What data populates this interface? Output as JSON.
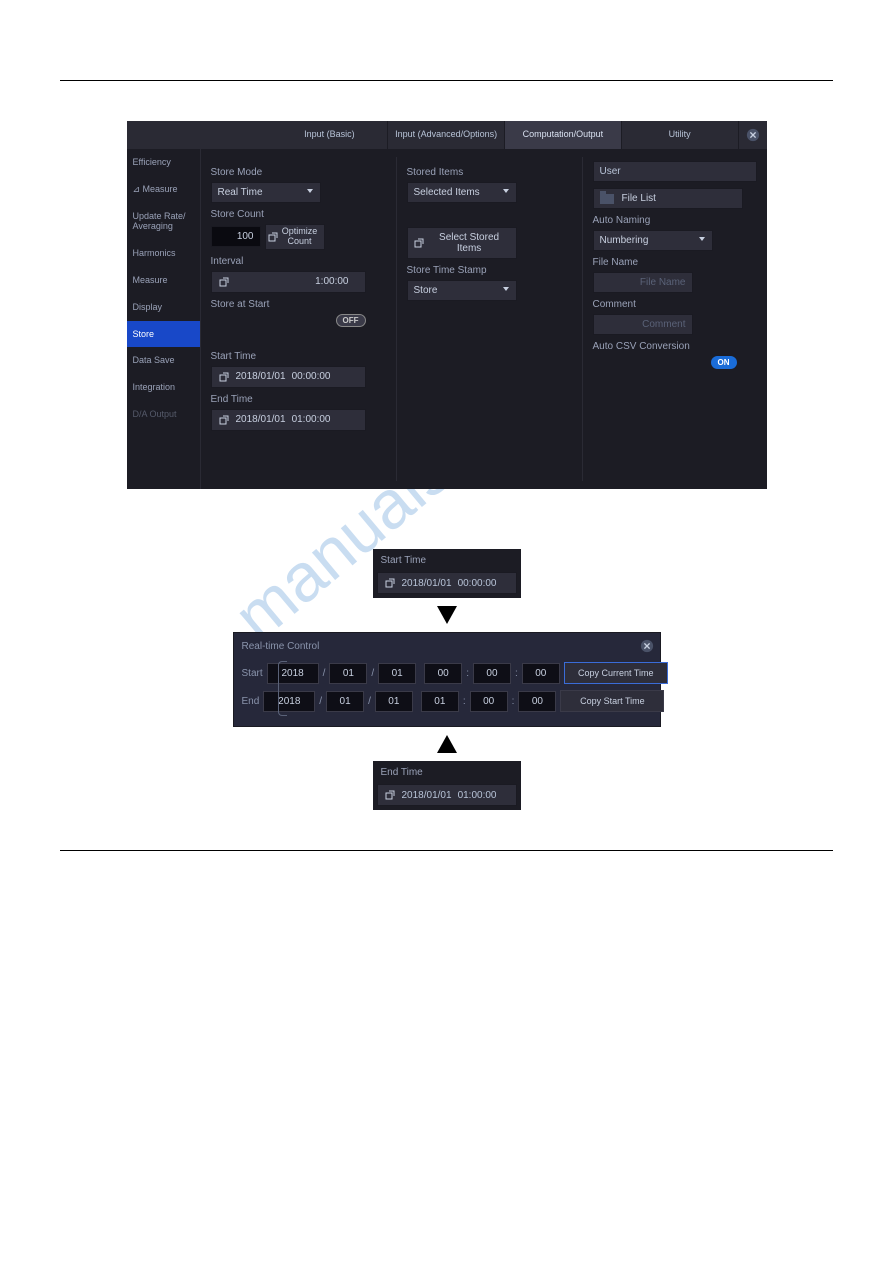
{
  "watermark": "manualshive.com",
  "tabs": [
    "Input\n(Basic)",
    "Input\n(Advanced/Options)",
    "Computation/Output",
    "Utility"
  ],
  "sidebar": [
    "Efficiency",
    "⊿ Measure",
    "Update Rate/\nAveraging",
    "Harmonics",
    "Measure",
    "Display",
    "Store",
    "Data Save",
    "Integration",
    "D/A Output"
  ],
  "col1": {
    "store_mode_label": "Store Mode",
    "store_mode_value": "Real Time",
    "store_count_label": "Store Count",
    "store_count_value": "100",
    "optimize_label": "Optimize Count",
    "interval_label": "Interval",
    "interval_value": "1:00:00",
    "store_at_start_label": "Store at Start",
    "store_at_start_state": "OFF",
    "start_time_label": "Start Time",
    "start_time_date": "2018/01/01",
    "start_time_time": "00:00:00",
    "end_time_label": "End Time",
    "end_time_date": "2018/01/01",
    "end_time_time": "01:00:00"
  },
  "col2": {
    "stored_items_label": "Stored Items",
    "stored_items_value": "Selected Items",
    "select_stored_label": "Select Stored Items",
    "timestamp_label": "Store Time Stamp",
    "timestamp_value": "Store"
  },
  "col3": {
    "user_label": "User",
    "file_list_label": "File List",
    "auto_naming_label": "Auto Naming",
    "auto_naming_value": "Numbering",
    "filename_label": "File Name",
    "filename_placeholder": "File Name",
    "comment_label": "Comment",
    "comment_placeholder": "Comment",
    "autocsv_label": "Auto CSV Conversion",
    "autocsv_state": "ON"
  },
  "mini": {
    "start_label": "Start Time",
    "start_date": "2018/01/01",
    "start_time": "00:00:00",
    "end_label": "End Time",
    "end_date": "2018/01/01",
    "end_time": "01:00:00"
  },
  "rtc": {
    "title": "Real-time Control",
    "start_label": "Start",
    "end_label": "End",
    "start": {
      "y": "2018",
      "mo": "01",
      "d": "01",
      "h": "00",
      "mi": "00",
      "s": "00"
    },
    "end": {
      "y": "2018",
      "mo": "01",
      "d": "01",
      "h": "01",
      "mi": "00",
      "s": "00"
    },
    "copy_current": "Copy Current Time",
    "copy_start": "Copy Start Time"
  }
}
